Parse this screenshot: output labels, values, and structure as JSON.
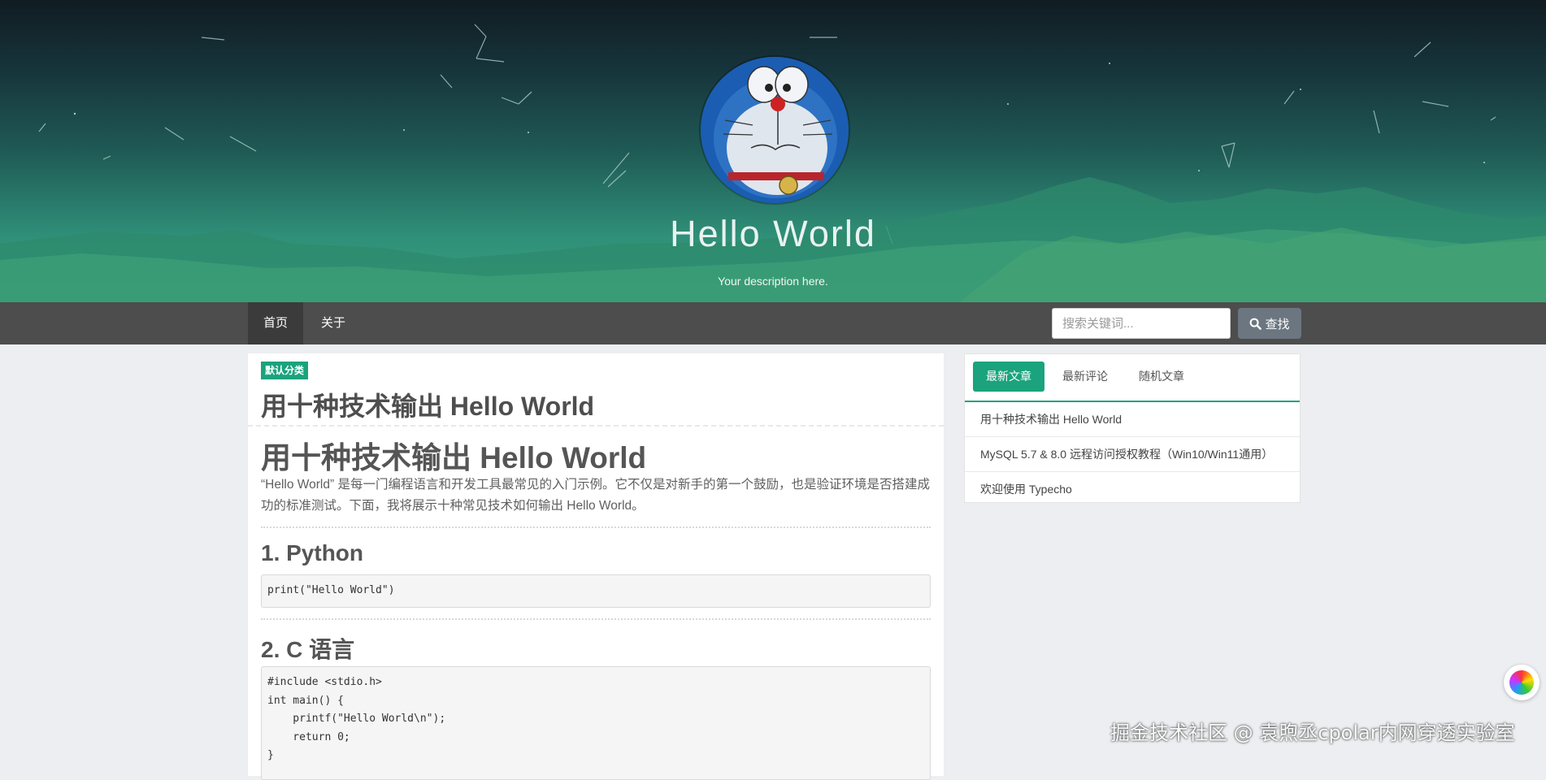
{
  "header": {
    "site_title": "Hello World",
    "site_description": "Your description here."
  },
  "nav": {
    "items": [
      {
        "label": "首页",
        "active": true
      },
      {
        "label": "关于",
        "active": false
      }
    ],
    "search_placeholder": "搜索关键词...",
    "search_button": "查找"
  },
  "post": {
    "category": "默认分类",
    "title": "用十种技术输出 Hello World",
    "content_heading": "用十种技术输出 Hello World",
    "intro": "“Hello World” 是每一门编程语言和开发工具最常见的入门示例。它不仅是对新手的第一个鼓励，也是验证环境是否搭建成功的标准测试。下面，我将展示十种常见技术如何输出 Hello World。",
    "sections": [
      {
        "heading": "1. Python",
        "code": "print(\"Hello World\")"
      },
      {
        "heading": "2. C 语言",
        "code": "#include <stdio.h>\nint main() {\n    printf(\"Hello World\\n\");\n    return 0;\n}"
      }
    ]
  },
  "sidebar": {
    "tabs": [
      {
        "label": "最新文章",
        "active": true
      },
      {
        "label": "最新评论",
        "active": false
      },
      {
        "label": "随机文章",
        "active": false
      }
    ],
    "items": [
      "用十种技术输出 Hello World",
      "MySQL 5.7 & 8.0 远程访问授权教程（Win10/Win11通用）",
      "欢迎使用 Typecho"
    ]
  },
  "watermark": "掘金技术社区 @ 袁煦丞cpolar内网穿透实验室",
  "icons": {
    "search": "search-icon",
    "float": "color-wheel-icon"
  },
  "colors": {
    "accent": "#1aa37d",
    "nav_bg": "#4d4d4d",
    "search_btn": "#6b7680"
  }
}
